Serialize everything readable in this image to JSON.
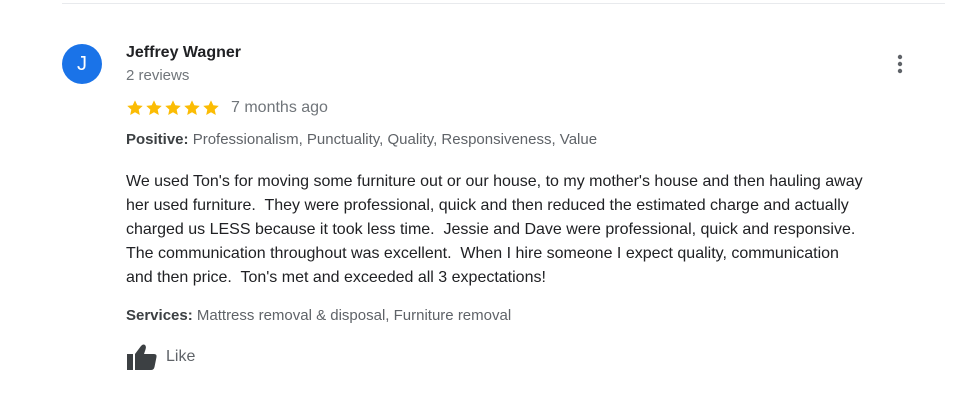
{
  "review": {
    "avatar_letter": "J",
    "avatar_color": "#1a73e8",
    "reviewer_name": "Jeffrey Wagner",
    "reviewer_reviews": "2 reviews",
    "rating": 5,
    "star_color": "#fbbc04",
    "date": "7 months ago",
    "positive_label": "Positive:",
    "positive_values": "Professionalism, Punctuality, Quality, Responsiveness, Value",
    "text_lines": [
      "We used Ton's for moving some furniture out or our house, to my mother's house and then hauling away",
      "her used furniture.  They were professional, quick and then reduced the estimated charge and actually",
      "charged us LESS because it took less time.  Jessie and Dave were professional, quick and responsive.",
      "The communication throughout was excellent.  When I hire someone I expect quality, communication",
      "and then price.  Ton's met and exceeded all 3 expectations!"
    ],
    "services_label": "Services:",
    "services_values": "Mattress removal & disposal, Furniture removal",
    "like_label": "Like",
    "icons": {
      "more": "more-vert-icon",
      "like": "thumbs-up-icon",
      "star": "star-icon"
    }
  }
}
